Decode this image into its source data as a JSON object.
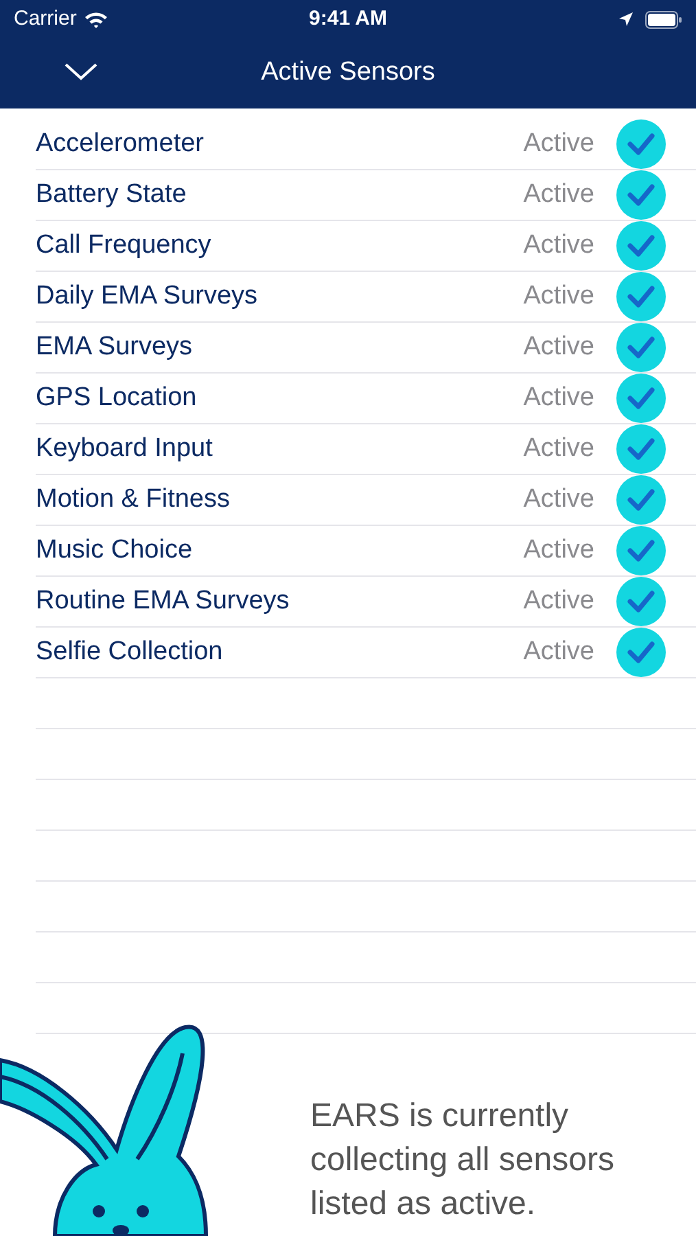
{
  "status_bar": {
    "carrier": "Carrier",
    "time": "9:41 AM"
  },
  "nav": {
    "title": "Active Sensors"
  },
  "sensors": [
    {
      "name": "Accelerometer",
      "status": "Active",
      "checked": true
    },
    {
      "name": "Battery State",
      "status": "Active",
      "checked": true
    },
    {
      "name": "Call Frequency",
      "status": "Active",
      "checked": true
    },
    {
      "name": "Daily EMA Surveys",
      "status": "Active",
      "checked": true
    },
    {
      "name": "EMA Surveys",
      "status": "Active",
      "checked": true
    },
    {
      "name": "GPS Location",
      "status": "Active",
      "checked": true
    },
    {
      "name": "Keyboard Input",
      "status": "Active",
      "checked": true
    },
    {
      "name": "Motion & Fitness",
      "status": "Active",
      "checked": true
    },
    {
      "name": "Music Choice",
      "status": "Active",
      "checked": true
    },
    {
      "name": "Routine EMA Surveys",
      "status": "Active",
      "checked": true
    },
    {
      "name": "Selfie Collection",
      "status": "Active",
      "checked": true
    }
  ],
  "footer_text": "EARS is currently collecting all sensors listed as active."
}
